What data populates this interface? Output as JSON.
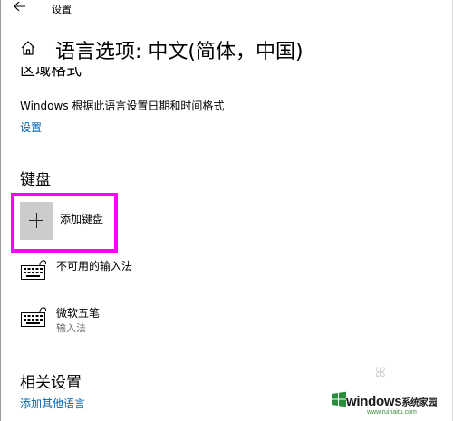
{
  "window": {
    "title": "设置"
  },
  "header": {
    "title": "语言选项: 中文(简体，中国)"
  },
  "region": {
    "cut_heading": "区域格式",
    "description": "Windows 根据此语言设置日期和时间格式",
    "settings_link": "设置"
  },
  "keyboards": {
    "heading": "键盘",
    "add_label": "添加键盘",
    "items": [
      {
        "name": "不可用的输入法",
        "sub": ""
      },
      {
        "name": "微软五笔",
        "sub": "输入法"
      }
    ]
  },
  "related": {
    "heading": "相关设置",
    "add_language_link": "添加其他语言"
  },
  "watermark": {
    "brand": "windows",
    "brand_cn": "系统家园",
    "url": "www.ruihaitu.com"
  },
  "colors": {
    "accent": "#0063b1",
    "highlight": "#ff00ff",
    "add_box": "#cccccc"
  }
}
